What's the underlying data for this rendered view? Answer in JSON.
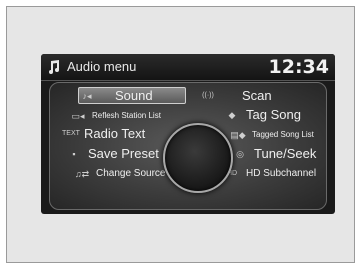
{
  "header": {
    "title": "Audio menu",
    "time": "12:34",
    "icon": "music-note-icon"
  },
  "menu": {
    "left": [
      {
        "label": "Sound",
        "icon": "sound-icon",
        "glyph": "♪◂",
        "selected": true
      },
      {
        "label": "Reflesh Station List",
        "icon": "refresh-station-icon",
        "glyph": "▭◂"
      },
      {
        "label": "Radio Text",
        "icon": "radio-text-icon",
        "glyph": "TEXT"
      },
      {
        "label": "Save Preset",
        "icon": "save-preset-icon",
        "glyph": "▪"
      },
      {
        "label": "Change Source",
        "icon": "change-source-icon",
        "glyph": "♫⇄"
      }
    ],
    "right": [
      {
        "label": "Scan",
        "icon": "scan-icon",
        "glyph": "((·))"
      },
      {
        "label": "Tag Song",
        "icon": "tag-song-icon",
        "glyph": "◆"
      },
      {
        "label": "Tagged Song List",
        "icon": "tagged-song-list-icon",
        "glyph": "▤◆"
      },
      {
        "label": "Tune/Seek",
        "icon": "tune-seek-icon",
        "glyph": "◎"
      },
      {
        "label": "HD Subchannel",
        "icon": "hd-subchannel-icon",
        "glyph": "HD"
      }
    ]
  },
  "colors": {
    "screen_bg": "#1a1a1a",
    "text": "#efefef",
    "selected_bg": "#7a7a7a"
  }
}
